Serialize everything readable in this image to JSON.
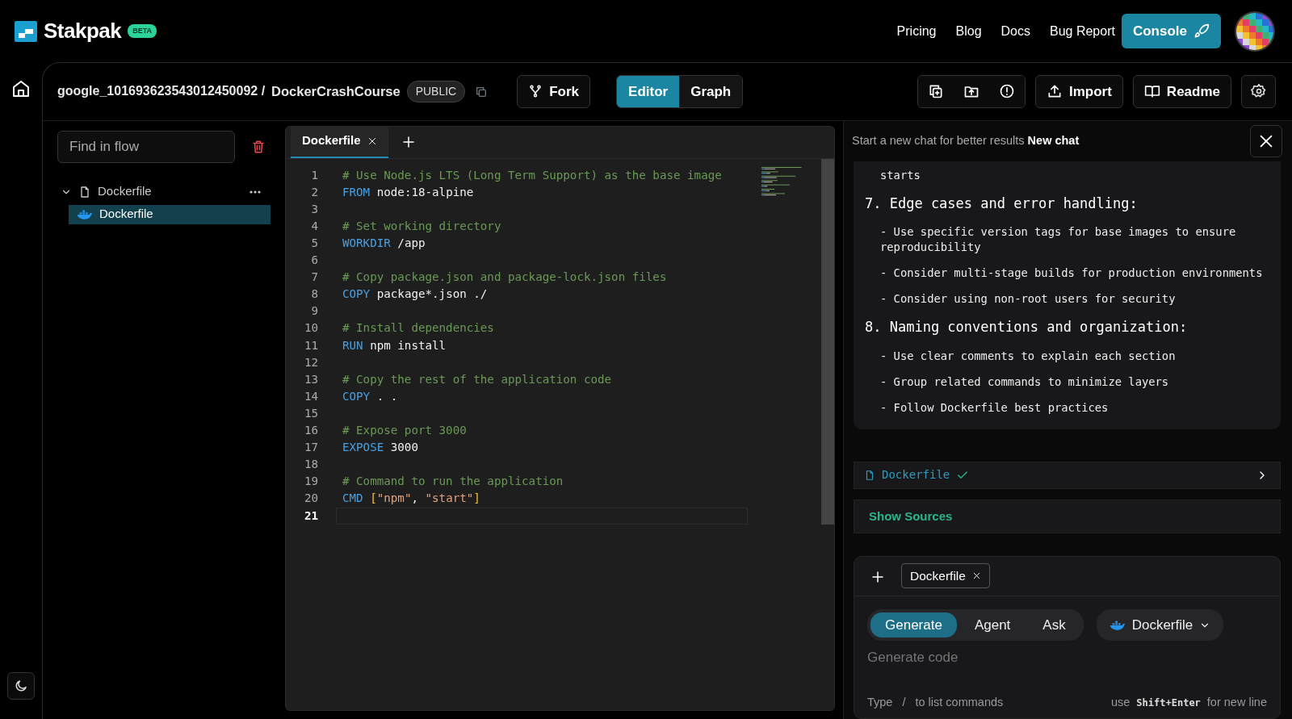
{
  "brand": {
    "name": "Stakpak",
    "badge": "BETA"
  },
  "nav_links": [
    "Pricing",
    "Blog",
    "Docs",
    "Bug Report"
  ],
  "console_button": "Console",
  "toolbar": {
    "owner": "google_101693623543012450092 /",
    "project": "DockerCrashCourse",
    "visibility": "PUBLIC",
    "fork": "Fork",
    "view_tabs": [
      {
        "label": "Editor",
        "selected": true
      },
      {
        "label": "Graph",
        "selected": false
      }
    ],
    "import": "Import",
    "readme": "Readme"
  },
  "sidebar": {
    "search": {
      "placeholder": "Find in flow"
    },
    "tree": [
      {
        "label": "Dockerfile",
        "kind": "file",
        "expanded": true,
        "selected": false,
        "children": [
          {
            "label": "Dockerfile",
            "kind": "docker",
            "selected": true
          }
        ]
      }
    ]
  },
  "editor": {
    "tabs": [
      {
        "label": "Dockerfile",
        "selected": true
      }
    ],
    "lines": [
      {
        "number": "1",
        "selected": false,
        "tokens": [
          {
            "kind": "comment",
            "text": "# Use Node.js LTS (Long Term Support) as the base image"
          }
        ]
      },
      {
        "number": "2",
        "selected": false,
        "tokens": [
          {
            "kind": "keyword",
            "text": "FROM"
          },
          {
            "kind": "plain",
            "text": " node:18-alpine"
          }
        ]
      },
      {
        "number": "3",
        "selected": false
      },
      {
        "number": "4",
        "selected": false,
        "tokens": [
          {
            "kind": "comment",
            "text": "# Set working directory"
          }
        ]
      },
      {
        "number": "5",
        "selected": false,
        "tokens": [
          {
            "kind": "keyword",
            "text": "WORKDIR"
          },
          {
            "kind": "plain",
            "text": " /app"
          }
        ]
      },
      {
        "number": "6",
        "selected": false
      },
      {
        "number": "7",
        "selected": false,
        "tokens": [
          {
            "kind": "comment",
            "text": "# Copy package.json and package-lock.json files"
          }
        ]
      },
      {
        "number": "8",
        "selected": false,
        "tokens": [
          {
            "kind": "keyword",
            "text": "COPY"
          },
          {
            "kind": "plain",
            "text": " package*.json ./"
          }
        ]
      },
      {
        "number": "9",
        "selected": false
      },
      {
        "number": "10",
        "selected": false,
        "tokens": [
          {
            "kind": "comment",
            "text": "# Install dependencies"
          }
        ]
      },
      {
        "number": "11",
        "selected": false,
        "tokens": [
          {
            "kind": "keyword",
            "text": "RUN"
          },
          {
            "kind": "plain",
            "text": " npm install"
          }
        ]
      },
      {
        "number": "12",
        "selected": false
      },
      {
        "number": "13",
        "selected": false,
        "tokens": [
          {
            "kind": "comment",
            "text": "# Copy the rest of the application code"
          }
        ]
      },
      {
        "number": "14",
        "selected": false,
        "tokens": [
          {
            "kind": "keyword",
            "text": "COPY"
          },
          {
            "kind": "plain",
            "text": " . ."
          }
        ]
      },
      {
        "number": "15",
        "selected": false
      },
      {
        "number": "16",
        "selected": false,
        "tokens": [
          {
            "kind": "comment",
            "text": "# Expose port 3000"
          }
        ]
      },
      {
        "number": "17",
        "selected": false,
        "tokens": [
          {
            "kind": "keyword",
            "text": "EXPOSE"
          },
          {
            "kind": "plain",
            "text": " 3000"
          }
        ]
      },
      {
        "number": "18",
        "selected": false
      },
      {
        "number": "19",
        "selected": false,
        "tokens": [
          {
            "kind": "comment",
            "text": "# Command to run the application"
          }
        ]
      },
      {
        "number": "20",
        "selected": false,
        "tokens": [
          {
            "kind": "keyword",
            "text": "CMD"
          },
          {
            "kind": "bracket",
            "text": " ["
          },
          {
            "kind": "string",
            "text": "\"npm\""
          },
          {
            "kind": "plain",
            "text": ", "
          },
          {
            "kind": "string",
            "text": "\"start\""
          },
          {
            "kind": "bracket",
            "text": "]"
          }
        ]
      },
      {
        "number": "21",
        "selected": true
      }
    ]
  },
  "chat": {
    "notice": "Start a new chat for better results",
    "new_chat": "New chat",
    "message": [
      {
        "kind": "item",
        "text": "starts"
      },
      {
        "kind": "heading",
        "text": "7. Edge cases and error handling:"
      },
      {
        "kind": "item",
        "text": "- Use specific version tags for base images to ensure reproducibility"
      },
      {
        "kind": "item",
        "text": "- Consider multi-stage builds for production environments"
      },
      {
        "kind": "item",
        "text": "- Consider using non-root users for security"
      },
      {
        "kind": "heading",
        "text": "8. Naming conventions and organization:"
      },
      {
        "kind": "item",
        "text": "- Use clear comments to explain each section"
      },
      {
        "kind": "item",
        "text": "- Group related commands to minimize layers"
      },
      {
        "kind": "item",
        "text": "- Follow Dockerfile best practices"
      }
    ],
    "file_card": {
      "name": "Dockerfile",
      "done": true
    },
    "show_sources": "Show Sources",
    "composer": {
      "context_chip": "Dockerfile",
      "modes": [
        {
          "label": "Generate",
          "selected": true
        },
        {
          "label": "Agent",
          "selected": false
        },
        {
          "label": "Ask",
          "selected": false
        }
      ],
      "file_select": "Dockerfile",
      "placeholder": "Generate code",
      "hint_left": [
        "Type",
        "/",
        "to list commands"
      ],
      "hint_use": "use",
      "hint_key": "Shift+Enter",
      "hint_right": "for new line"
    }
  }
}
